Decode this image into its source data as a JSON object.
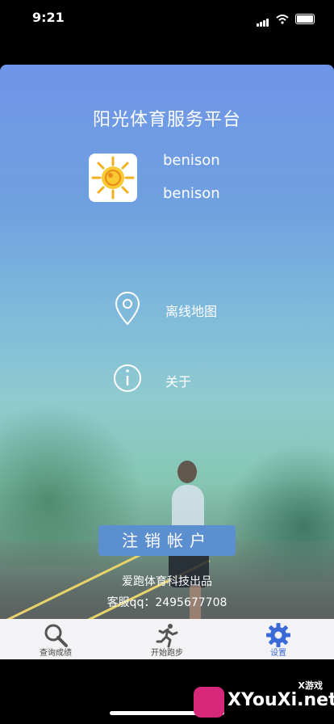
{
  "status": {
    "time": "9:21"
  },
  "app": {
    "title": "阳光体育服务平台",
    "username1": "benison",
    "username2": "benison"
  },
  "menu": [
    {
      "label": "离线地图",
      "icon": "location-pin-icon"
    },
    {
      "label": "关于",
      "icon": "info-icon"
    }
  ],
  "buttons": {
    "logout_label": "注销帐户"
  },
  "footer": {
    "line1": "爱跑体育科技出品",
    "line2": "客服qq：2495677708"
  },
  "tabs": [
    {
      "label": "查询成绩",
      "icon": "search-icon"
    },
    {
      "label": "开始跑步",
      "icon": "running-icon"
    },
    {
      "label": "设置",
      "icon": "gear-icon",
      "active": true
    }
  ],
  "watermark": {
    "caption": "X游戏",
    "brand": "XYouXi.net"
  },
  "colors": {
    "accent": "#3a6ad6",
    "button": "#5b8fd0"
  }
}
